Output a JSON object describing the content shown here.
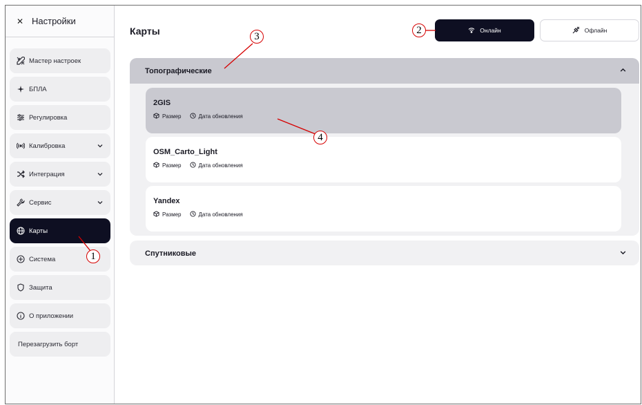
{
  "sidebar": {
    "title": "Настройки",
    "items": [
      {
        "label": "Мастер настроек",
        "icon": "wizard-tools-icon",
        "has_chevron": false,
        "active": false
      },
      {
        "label": "БПЛА",
        "icon": "plane-icon",
        "has_chevron": false,
        "active": false
      },
      {
        "label": "Регулировка",
        "icon": "sliders-icon",
        "has_chevron": false,
        "active": false
      },
      {
        "label": "Калибровка",
        "icon": "radio-signal-icon",
        "has_chevron": true,
        "active": false
      },
      {
        "label": "Интеграция",
        "icon": "shuffle-icon",
        "has_chevron": true,
        "active": false
      },
      {
        "label": "Сервис",
        "icon": "wrench-icon",
        "has_chevron": true,
        "active": false
      },
      {
        "label": "Карты",
        "icon": "globe-icon",
        "has_chevron": false,
        "active": true
      },
      {
        "label": "Система",
        "icon": "system-icon",
        "has_chevron": false,
        "active": false
      },
      {
        "label": "Защита",
        "icon": "shield-icon",
        "has_chevron": false,
        "active": false
      },
      {
        "label": "О приложении",
        "icon": "info-icon",
        "has_chevron": false,
        "active": false
      },
      {
        "label": "Перезагрузить борт",
        "icon": "",
        "has_chevron": false,
        "active": false
      }
    ]
  },
  "main": {
    "title": "Карты",
    "mode_buttons": {
      "online_label": "Онлайн",
      "offline_label": "Офлайн",
      "selected": "online"
    },
    "groups": [
      {
        "title": "Топографические",
        "expanded": true,
        "maps": [
          {
            "name": "2GIS",
            "size_label": "Размер",
            "updated_label": "Дата обновления",
            "selected": true
          },
          {
            "name": "OSM_Carto_Light",
            "size_label": "Размер",
            "updated_label": "Дата обновления",
            "selected": false
          },
          {
            "name": "Yandex",
            "size_label": "Размер",
            "updated_label": "Дата обновления",
            "selected": false
          }
        ]
      },
      {
        "title": "Спутниковые",
        "expanded": false,
        "maps": []
      }
    ]
  },
  "annotations": [
    "1",
    "2",
    "3",
    "4"
  ],
  "colors": {
    "accent_dark": "#0e0f22",
    "selected_gray": "#c9c9d0",
    "panel_gray": "#f1f1f3",
    "annotation_red": "#d60000"
  }
}
